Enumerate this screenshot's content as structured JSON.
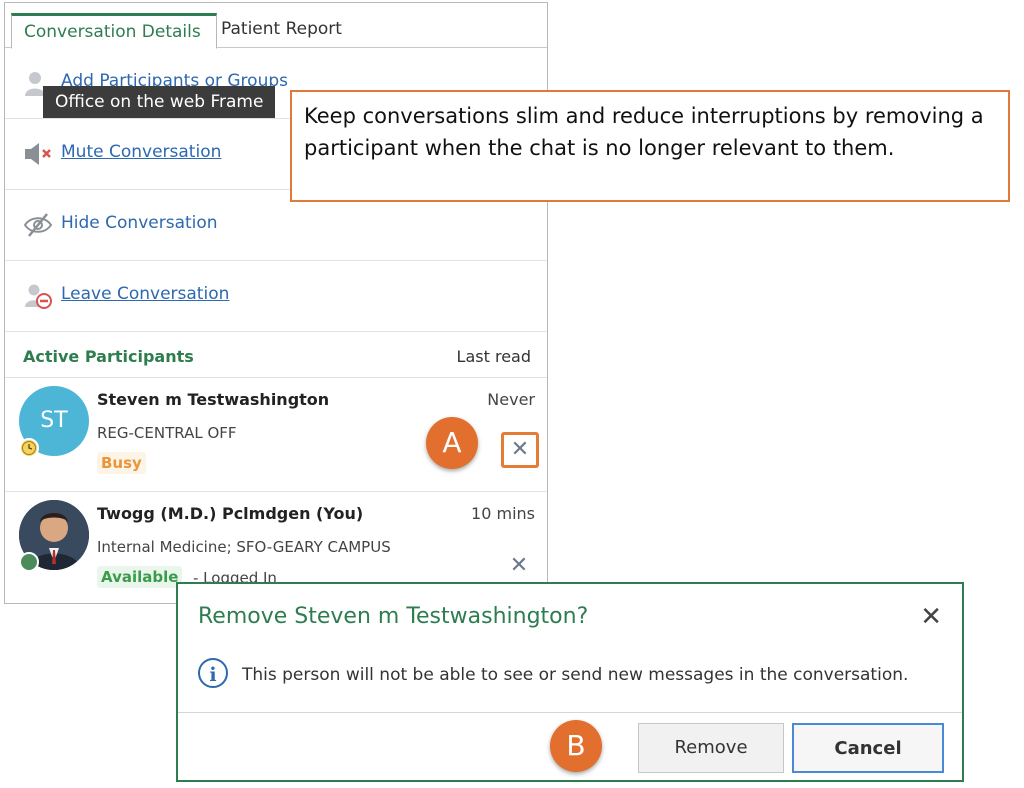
{
  "tabs": {
    "conversation_details": "Conversation Details",
    "patient_report": "Patient Report"
  },
  "actions": {
    "add_participants": "Add Participants or Groups",
    "mute": "Mute Conversation",
    "hide": "Hide Conversation",
    "leave": "Leave Conversation"
  },
  "tooltip": "Office on the web Frame",
  "callout": "Keep conversations slim and reduce interruptions by removing a participant when the chat is no longer relevant to them.",
  "participants": {
    "header": "Active Participants",
    "last_read_label": "Last read",
    "items": [
      {
        "initials": "ST",
        "name": "Steven m Testwashington",
        "dept": "REG-CENTRAL OFF",
        "status": "Busy",
        "last_read": "Never"
      },
      {
        "name": "Twogg (M.D.) Pclmdgen (You)",
        "dept": "Internal Medicine; SFO-GEARY CAMPUS",
        "status": "Available",
        "substatus": "- Logged In",
        "last_read": "10 mins"
      }
    ]
  },
  "markers": {
    "a": "A",
    "b": "B"
  },
  "dialog": {
    "title": "Remove Steven m Testwashington?",
    "message": "This person will not be able to see or send new messages in the conversation.",
    "remove_label": "Remove",
    "cancel_label": "Cancel"
  },
  "colors": {
    "accent_green": "#2e7d4f",
    "link_blue": "#2d68b0",
    "highlight_orange": "#e26f2e",
    "busy": "#e9953a",
    "available": "#3a9b4a"
  }
}
